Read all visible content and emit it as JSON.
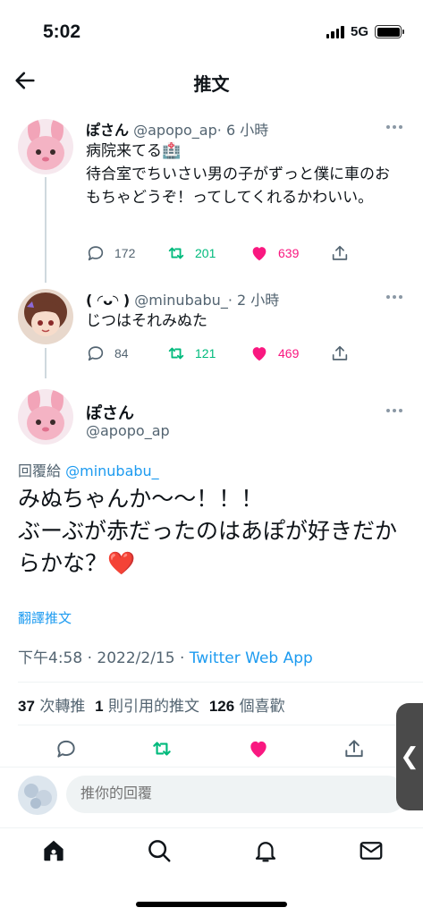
{
  "status_bar": {
    "time": "5:02",
    "network": "5G"
  },
  "nav": {
    "title": "推文"
  },
  "tweets": [
    {
      "name": "ぽさん",
      "handle": "@apopo_ap",
      "time": "· 6 小時",
      "text": "病院来てる🏥\n待合室でちいさい男の子がずっと僕に車のおもちゃどうぞ！ってしてくれるかわいい。",
      "replies": "172",
      "retweets": "201",
      "likes": "639"
    },
    {
      "name": "( ◜ᴗ◝ )",
      "handle": "@minubabu_",
      "time": "· 2 小時",
      "text": "じつはそれみぬた",
      "replies": "84",
      "retweets": "121",
      "likes": "469"
    }
  ],
  "main_tweet": {
    "name": "ぽさん",
    "handle": "@apopo_ap",
    "reply_prefix": "回覆給",
    "reply_mention": "@minubabu_",
    "text": "みぬちゃんか〜〜！！！\nぶーぶが赤だったのはあぽが好きだからかな？❤️",
    "translate": "翻譯推文",
    "datetime": "下午4:58 · 2022/2/15 · ",
    "source": "Twitter Web App",
    "retweet_count": "37",
    "retweet_label": " 次轉推  ",
    "quote_count": "1",
    "quote_label": " 則引用的推文  ",
    "like_count": "126",
    "like_label": " 個喜歡"
  },
  "reply_bar": {
    "placeholder": "推你的回覆"
  },
  "side_handle": {
    "label": "❮"
  },
  "colors": {
    "retweet": "#00ba7c",
    "like": "#f91880",
    "link": "#1d9bf0",
    "secondary": "#536471"
  },
  "icons": {
    "nav": "back-arrow-icon",
    "actions": [
      "reply-icon",
      "retweet-icon",
      "like-heart-icon",
      "share-icon"
    ],
    "tabs": [
      "home-icon",
      "search-icon",
      "notifications-bell-icon",
      "messages-mail-icon"
    ]
  }
}
